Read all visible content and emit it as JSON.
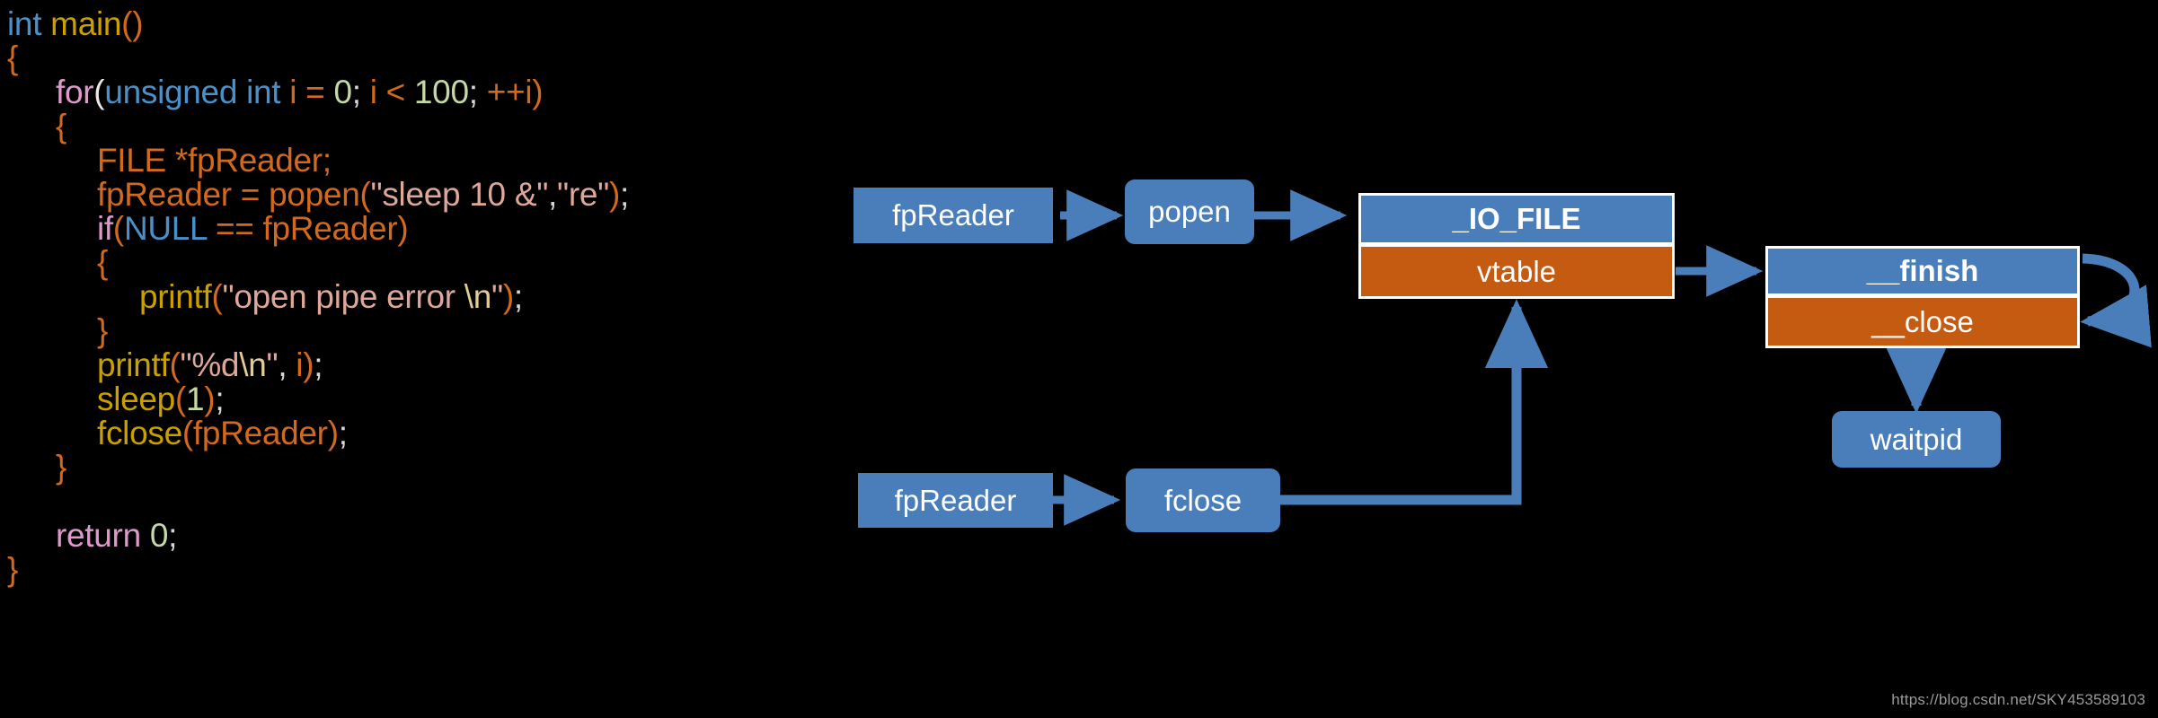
{
  "meta": {
    "background_color": "#000000",
    "accent_blue": "#4a7ebb",
    "accent_orange": "#c55a11",
    "arrow_color": "#4a7ebb",
    "watermark": "https://blog.csdn.net/SKY453589103"
  },
  "code": {
    "language": "c",
    "lines": [
      {
        "indent": 0,
        "tokens": [
          {
            "text": "int",
            "cls": "t-type"
          },
          {
            "text": " ",
            "cls": "t-white"
          },
          {
            "text": "main",
            "cls": "t-fnname"
          },
          {
            "text": "()",
            "cls": "t-punc"
          }
        ]
      },
      {
        "indent": 0,
        "tokens": [
          {
            "text": "{",
            "cls": "t-brace"
          }
        ]
      },
      {
        "indent": 1,
        "tokens": [
          {
            "text": "for",
            "cls": "t-kw"
          },
          {
            "text": "(",
            "cls": "t-white"
          },
          {
            "text": "unsigned int",
            "cls": "t-type"
          },
          {
            "text": " ",
            "cls": "t-white"
          },
          {
            "text": "i",
            "cls": "t-ident"
          },
          {
            "text": " = ",
            "cls": "t-op"
          },
          {
            "text": "0",
            "cls": "t-num"
          },
          {
            "text": ";",
            "cls": "t-semi"
          },
          {
            "text": " ",
            "cls": "t-white"
          },
          {
            "text": "i",
            "cls": "t-ident"
          },
          {
            "text": " < ",
            "cls": "t-op"
          },
          {
            "text": "100",
            "cls": "t-num"
          },
          {
            "text": ";",
            "cls": "t-semi"
          },
          {
            "text": " ",
            "cls": "t-white"
          },
          {
            "text": "++",
            "cls": "t-op"
          },
          {
            "text": "i",
            "cls": "t-ident"
          },
          {
            "text": ")",
            "cls": "t-punc"
          }
        ]
      },
      {
        "indent": 1,
        "tokens": [
          {
            "text": "{",
            "cls": "t-brace"
          }
        ]
      },
      {
        "indent": 2,
        "tokens": [
          {
            "text": "FILE *fpReader",
            "cls": "t-ident"
          },
          {
            "text": ";",
            "cls": "t-ident"
          }
        ]
      },
      {
        "indent": 2,
        "tokens": [
          {
            "text": "fpReader",
            "cls": "t-ident"
          },
          {
            "text": " = ",
            "cls": "t-op"
          },
          {
            "text": "popen",
            "cls": "t-ident"
          },
          {
            "text": "(",
            "cls": "t-punc"
          },
          {
            "text": "\"sleep 10 &\"",
            "cls": "t-str"
          },
          {
            "text": ",",
            "cls": "t-semi"
          },
          {
            "text": "\"re\"",
            "cls": "t-str"
          },
          {
            "text": ")",
            "cls": "t-punc"
          },
          {
            "text": ";",
            "cls": "t-semi"
          }
        ]
      },
      {
        "indent": 2,
        "tokens": [
          {
            "text": "if",
            "cls": "t-kw"
          },
          {
            "text": "(",
            "cls": "t-punc"
          },
          {
            "text": "NULL",
            "cls": "t-type"
          },
          {
            "text": " == ",
            "cls": "t-op"
          },
          {
            "text": "fpReader",
            "cls": "t-ident"
          },
          {
            "text": ")",
            "cls": "t-punc"
          }
        ]
      },
      {
        "indent": 2,
        "tokens": [
          {
            "text": "{",
            "cls": "t-brace"
          }
        ]
      },
      {
        "indent": 3,
        "tokens": [
          {
            "text": "printf",
            "cls": "t-fnname"
          },
          {
            "text": "(",
            "cls": "t-punc"
          },
          {
            "text": "\"open pipe error ",
            "cls": "t-str"
          },
          {
            "text": "\\n",
            "cls": "t-esc"
          },
          {
            "text": "\"",
            "cls": "t-str"
          },
          {
            "text": ")",
            "cls": "t-punc"
          },
          {
            "text": ";",
            "cls": "t-semi"
          }
        ]
      },
      {
        "indent": 2,
        "tokens": [
          {
            "text": "}",
            "cls": "t-brace"
          }
        ]
      },
      {
        "indent": 2,
        "tokens": [
          {
            "text": "printf",
            "cls": "t-fnname"
          },
          {
            "text": "(",
            "cls": "t-punc"
          },
          {
            "text": "\"%d",
            "cls": "t-str"
          },
          {
            "text": "\\n",
            "cls": "t-esc"
          },
          {
            "text": "\"",
            "cls": "t-str"
          },
          {
            "text": ",",
            "cls": "t-semi"
          },
          {
            "text": " ",
            "cls": "t-white"
          },
          {
            "text": "i",
            "cls": "t-ident"
          },
          {
            "text": ")",
            "cls": "t-punc"
          },
          {
            "text": ";",
            "cls": "t-semi"
          }
        ]
      },
      {
        "indent": 2,
        "tokens": [
          {
            "text": "sleep",
            "cls": "t-fnname"
          },
          {
            "text": "(",
            "cls": "t-punc"
          },
          {
            "text": "1",
            "cls": "t-num"
          },
          {
            "text": ")",
            "cls": "t-punc"
          },
          {
            "text": ";",
            "cls": "t-semi"
          }
        ]
      },
      {
        "indent": 2,
        "tokens": [
          {
            "text": "fclose",
            "cls": "t-fnname"
          },
          {
            "text": "(",
            "cls": "t-punc"
          },
          {
            "text": "fpReader",
            "cls": "t-ident"
          },
          {
            "text": ")",
            "cls": "t-punc"
          },
          {
            "text": ";",
            "cls": "t-semi"
          }
        ]
      },
      {
        "indent": 1,
        "tokens": [
          {
            "text": "}",
            "cls": "t-brace"
          }
        ]
      },
      {
        "indent": 0,
        "tokens": []
      },
      {
        "indent": 1,
        "tokens": [
          {
            "text": "return",
            "cls": "t-kw"
          },
          {
            "text": " ",
            "cls": "t-white"
          },
          {
            "text": "0",
            "cls": "t-num"
          },
          {
            "text": ";",
            "cls": "t-semi"
          }
        ]
      },
      {
        "indent": 0,
        "tokens": [
          {
            "text": "}",
            "cls": "t-brace"
          }
        ]
      }
    ]
  },
  "diagram": {
    "nodes": {
      "fp_reader_top": {
        "label": "fpReader",
        "shape": "rect",
        "fill": "#4a7ebb"
      },
      "popen": {
        "label": "popen",
        "shape": "round",
        "fill": "#4a7ebb"
      },
      "io_file": {
        "label": "_IO_FILE",
        "shape": "rect",
        "fill": "#4a7ebb",
        "bold": true
      },
      "vtable": {
        "label": "vtable",
        "shape": "rect",
        "fill": "#c55a11"
      },
      "finish": {
        "label": "__finish",
        "shape": "rect",
        "fill": "#4a7ebb",
        "bold": true
      },
      "close": {
        "label": "__close",
        "shape": "rect",
        "fill": "#c55a11"
      },
      "waitpid": {
        "label": "waitpid",
        "shape": "round",
        "fill": "#4a7ebb"
      },
      "fp_reader_bot": {
        "label": "fpReader",
        "shape": "rect",
        "fill": "#4a7ebb"
      },
      "fclose": {
        "label": "fclose",
        "shape": "round",
        "fill": "#4a7ebb"
      }
    },
    "edges": [
      {
        "from": "fp_reader_top",
        "to": "popen",
        "kind": "straight"
      },
      {
        "from": "popen",
        "to": "io_file",
        "kind": "straight"
      },
      {
        "from": "io_file",
        "to": "finish",
        "kind": "straight"
      },
      {
        "from": "finish",
        "to": "waitpid",
        "kind": "down"
      },
      {
        "from": "close",
        "to": "close",
        "kind": "self-loop"
      },
      {
        "from": "fp_reader_bot",
        "to": "fclose",
        "kind": "straight"
      },
      {
        "from": "fclose",
        "to": "vtable",
        "kind": "elbow-up"
      }
    ]
  }
}
